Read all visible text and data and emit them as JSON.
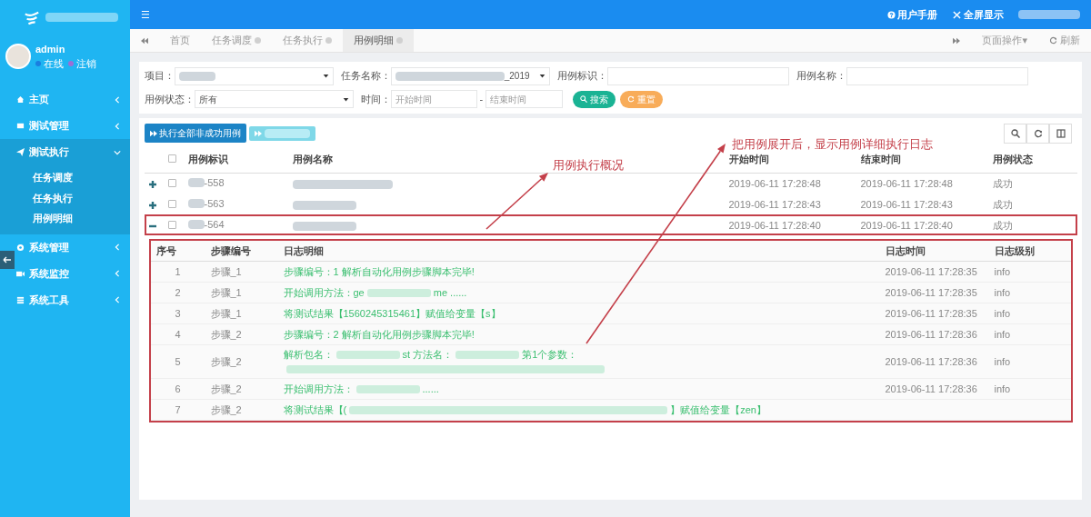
{
  "sidebar": {
    "user": {
      "name": "admin",
      "statuses": [
        {
          "label": "在线",
          "color": "#1a7ee0"
        },
        {
          "label": "注销",
          "color": "#9b6fd6"
        }
      ]
    },
    "menu": [
      {
        "label": "主页",
        "expanded": false
      },
      {
        "label": "测试管理",
        "expanded": false
      },
      {
        "label": "测试执行",
        "expanded": true,
        "children": [
          {
            "label": "任务调度"
          },
          {
            "label": "任务执行"
          },
          {
            "label": "用例明细"
          }
        ]
      },
      {
        "label": "系统管理",
        "expanded": false
      },
      {
        "label": "系统监控",
        "expanded": false
      },
      {
        "label": "系统工具",
        "expanded": false
      }
    ]
  },
  "header": {
    "menu_glyph": "☰",
    "links": [
      {
        "label": "用户手册"
      },
      {
        "label": "全屏显示"
      }
    ]
  },
  "tabs": [
    {
      "label": "首页",
      "selected": false,
      "closable": false
    },
    {
      "label": "任务调度",
      "selected": false,
      "closable": true
    },
    {
      "label": "任务执行",
      "selected": false,
      "closable": true
    },
    {
      "label": "用例明细",
      "selected": true,
      "closable": true
    }
  ],
  "tab_actions": [
    {
      "label": "页面操作▾"
    },
    {
      "label": "刷新"
    }
  ],
  "filters": [
    [
      {
        "label": "项目：",
        "kind": "select",
        "blurred": true
      },
      {
        "label": "任务名称：",
        "kind": "select",
        "value": "_2019",
        "blurred": true
      },
      {
        "label": "用例标识：",
        "kind": "input"
      },
      {
        "label": "用例名称：",
        "kind": "input"
      }
    ],
    [
      {
        "label": "用例状态：",
        "kind": "select",
        "value": "所有"
      },
      {
        "label": "时间：",
        "kind": "range",
        "placeholder": "开始时间",
        "placeholder_end": "结束时间",
        "separator": "-"
      }
    ]
  ],
  "filter_buttons": [
    {
      "label": "搜索",
      "kind": "search"
    },
    {
      "label": "重置",
      "kind": "reset"
    }
  ],
  "toolbar": {
    "buttons": [
      {
        "label": "执行全部非成功用例",
        "disabled": false
      },
      {
        "disabled": true
      }
    ]
  },
  "cases": {
    "columns": [
      "用例标识",
      "用例名称",
      "开始时间",
      "结束时间",
      "用例状态"
    ],
    "header_checked": false,
    "rows": [
      {
        "id": "-558",
        "start": "2019-06-11 17:28:48",
        "end": "2019-06-11 17:28:48",
        "status": "成功",
        "expanded": false,
        "checked": false
      },
      {
        "id": "-563",
        "start": "2019-06-11 17:28:43",
        "end": "2019-06-11 17:28:43",
        "status": "成功",
        "expanded": false,
        "checked": false
      },
      {
        "id": "-564",
        "start": "2019-06-11 17:28:40",
        "end": "2019-06-11 17:28:40",
        "status": "成功",
        "expanded": true,
        "checked": false,
        "annotated": true
      }
    ]
  },
  "log": {
    "annotated": true,
    "columns": [
      "序号",
      "步骤编号",
      "日志明细",
      "日志时间",
      "日志级别"
    ],
    "rows": [
      {
        "no": "1",
        "step": "步骤_1",
        "detail": [
          {
            "kind": "text",
            "text": "步骤编号：1 解析自动化用例步骤脚本完毕!"
          }
        ],
        "time": "2019-06-11 17:28:35",
        "level": "info"
      },
      {
        "no": "2",
        "step": "步骤_1",
        "detail": [
          {
            "kind": "text",
            "text": "开始调用方法：ge"
          },
          {
            "kind": "blur"
          },
          {
            "kind": "text",
            "text": "me ......"
          }
        ],
        "time": "2019-06-11 17:28:35",
        "level": "info"
      },
      {
        "no": "3",
        "step": "步骤_1",
        "detail": [
          {
            "kind": "text",
            "text": "将测试结果【1560245315461】赋值给变量【s】"
          }
        ],
        "time": "2019-06-11 17:28:35",
        "level": "info"
      },
      {
        "no": "4",
        "step": "步骤_2",
        "detail": [
          {
            "kind": "text",
            "text": "步骤编号：2 解析自动化用例步骤脚本完毕!"
          }
        ],
        "time": "2019-06-11 17:28:36",
        "level": "info"
      },
      {
        "no": "5",
        "step": "步骤_2",
        "detail": [
          {
            "kind": "text",
            "text": "解析包名："
          },
          {
            "kind": "blur"
          },
          {
            "kind": "text",
            "text": "st 方法名："
          },
          {
            "kind": "blur"
          },
          {
            "kind": "text",
            "text": "第1个参数："
          },
          {
            "kind": "blurwide"
          }
        ],
        "time": "2019-06-11 17:28:36",
        "level": "info"
      },
      {
        "no": "6",
        "step": "步骤_2",
        "detail": [
          {
            "kind": "text",
            "text": "开始调用方法："
          },
          {
            "kind": "blur"
          },
          {
            "kind": "text",
            "text": "......"
          }
        ],
        "time": "2019-06-11 17:28:36",
        "level": "info"
      },
      {
        "no": "7",
        "step": "步骤_2",
        "detail": [
          {
            "kind": "text",
            "text": "将测试结果【("
          },
          {
            "kind": "blurwide"
          },
          {
            "kind": "text",
            "text": "】赋值给变量【zen】"
          }
        ]
      }
    ]
  },
  "annotations": [
    {
      "text": "用例执行概况"
    },
    {
      "text": "把用例展开后，显示用例详细执行日志"
    }
  ]
}
